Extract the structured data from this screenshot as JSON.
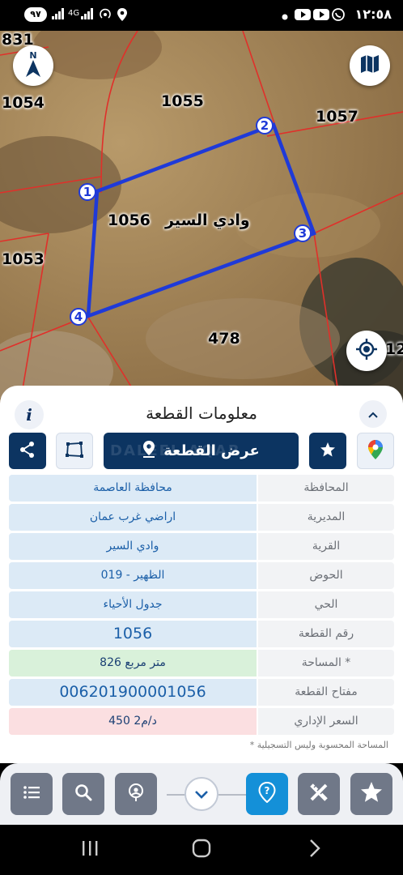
{
  "status_bar": {
    "time": "١٢:٥٨",
    "battery": "٩٧",
    "network": "4G"
  },
  "map": {
    "parcel_labels": [
      "831",
      "1054",
      "1055",
      "1057",
      "1056",
      "1053",
      "478",
      "12"
    ],
    "area_name": "وادي السير",
    "vertices": [
      "1",
      "2",
      "3",
      "4"
    ],
    "buttons": [
      "compass-icon",
      "map-layers-icon",
      "locate-icon"
    ]
  },
  "panel": {
    "title": "معلومات القطعة",
    "show_parcel_label": "عرض القطعة",
    "watermark": "DALEEL AQAR",
    "rows": [
      {
        "label": "المحافظة",
        "value": "محافظة العاصمة",
        "style": "normal"
      },
      {
        "label": "المديرية",
        "value": "اراضي غرب عمان",
        "style": "normal"
      },
      {
        "label": "القرية",
        "value": "وادي السير",
        "style": "normal"
      },
      {
        "label": "الحوض",
        "value": "الظهير - 019",
        "style": "normal"
      },
      {
        "label": "الحي",
        "value": "جدول الأحياء",
        "style": "normal"
      },
      {
        "label": "رقم القطعة",
        "value": "1056",
        "style": "big"
      },
      {
        "label": "المساحة *",
        "value": "826  متر مربع",
        "style": "green"
      },
      {
        "label": "مفتاح القطعة",
        "value": "006201900001056",
        "style": "big"
      },
      {
        "label": "السعر الإداري",
        "value": "450 د/م2",
        "style": "pink"
      }
    ],
    "footnote": "* المساحة المحسوبة وليس التسجيلية"
  },
  "colors": {
    "primary_dark": "#0c3461",
    "accent_blue": "#1490d8",
    "parcel_outline": "#1f3ad8",
    "boundary_red": "#e0302a"
  }
}
